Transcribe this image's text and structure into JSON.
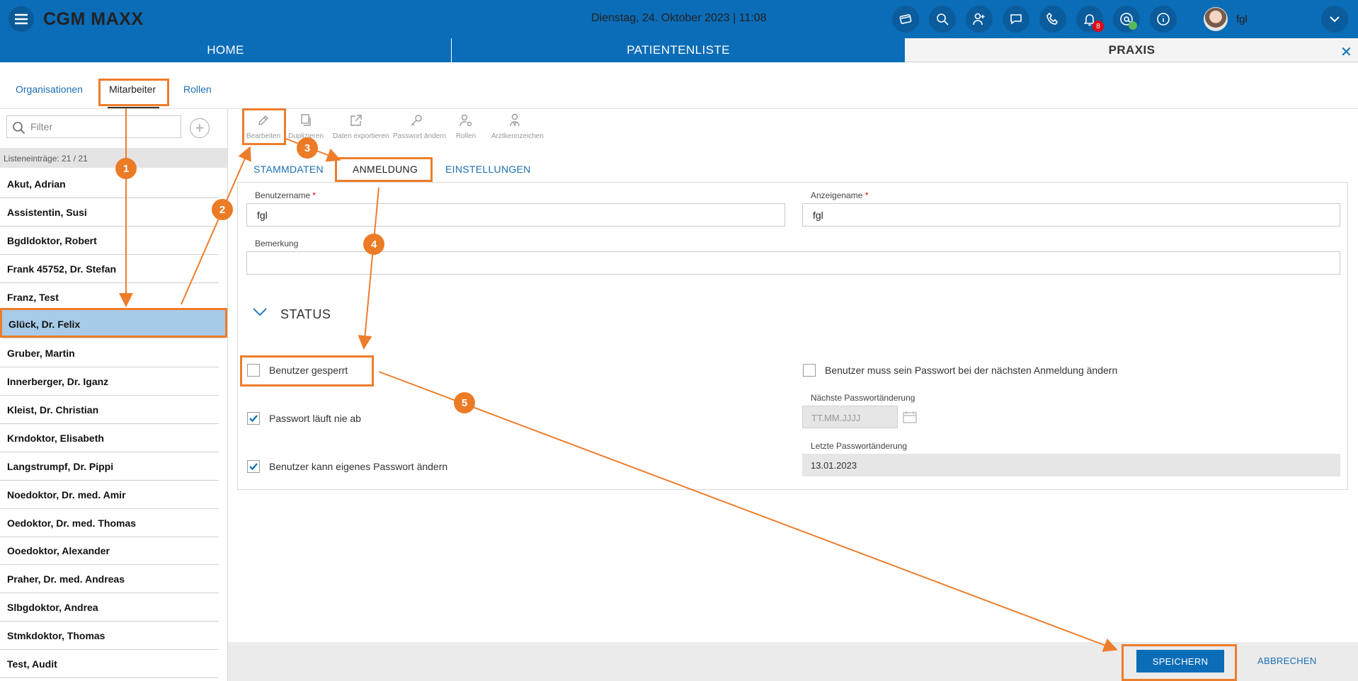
{
  "app": {
    "title": "CGM MAXX",
    "datetime": "Dienstag, 24. Oktober 2023 | 11:08",
    "username": "fgl",
    "notification_count": "8"
  },
  "main_tabs": [
    {
      "label": "HOME"
    },
    {
      "label": "PATIENTENLISTE"
    },
    {
      "label": "PRAXIS"
    }
  ],
  "sub_tabs": [
    {
      "label": "Organisationen"
    },
    {
      "label": "Mitarbeiter"
    },
    {
      "label": "Rollen"
    }
  ],
  "list": {
    "filter_placeholder": "Filter",
    "count_text": "Listeneinträge: 21 / 21",
    "items": [
      "Akut, Adrian",
      "Assistentin, Susi",
      "Bgdldoktor, Robert",
      "Frank 45752, Dr. Stefan",
      "Franz, Test",
      "Glück, Dr. Felix",
      "Gruber, Martin",
      "Innerberger, Dr. Iganz",
      "Kleist, Dr. Christian",
      "Krndoktor, Elisabeth",
      "Langstrumpf, Dr. Pippi",
      "Noedoktor, Dr. med. Amir",
      "Oedoktor, Dr. med. Thomas",
      "Ooedoktor, Alexander",
      "Praher, Dr. med. Andreas",
      "Slbgdoktor, Andrea",
      "Stmkdoktor, Thomas",
      "Test, Audit"
    ],
    "selected_index": 5
  },
  "toolbar": [
    {
      "label": "Bearbeiten",
      "icon": "pencil-icon"
    },
    {
      "label": "Duplizieren",
      "icon": "duplicate-icon"
    },
    {
      "label": "Daten exportieren",
      "icon": "export-icon"
    },
    {
      "label": "Passwort ändern",
      "icon": "key-icon"
    },
    {
      "label": "Rollen",
      "icon": "user-gear-icon"
    },
    {
      "label": "Arztkennzeichen",
      "icon": "doctor-icon"
    }
  ],
  "content_tabs": [
    {
      "label": "STAMMDATEN"
    },
    {
      "label": "ANMELDUNG"
    },
    {
      "label": "EINSTELLUNGEN"
    }
  ],
  "form": {
    "benutzername_label": "Benutzername",
    "benutzername_value": "fgl",
    "anzeigename_label": "Anzeigename",
    "anzeigename_value": "fgl",
    "required_marker": "*",
    "bemerkung_label": "Bemerkung",
    "bemerkung_value": "",
    "status_title": "STATUS",
    "benutzer_gesperrt_label": "Benutzer gesperrt",
    "benutzer_gesperrt_checked": false,
    "passwort_nie_ab_label": "Passwort läuft nie ab",
    "passwort_nie_ab_checked": true,
    "eigenes_passwort_label": "Benutzer kann eigenes Passwort ändern",
    "eigenes_passwort_checked": true,
    "muss_aendern_label": "Benutzer muss sein Passwort bei der nächsten Anmeldung ändern",
    "muss_aendern_checked": false,
    "naechste_label": "Nächste Passwortänderung",
    "naechste_placeholder": "TT.MM.JJJJ",
    "letzte_label": "Letzte Passwortänderung",
    "letzte_value": "13.01.2023"
  },
  "actions": {
    "save_label": "SPEICHERN",
    "cancel_label": "ABBRECHEN"
  },
  "annotation": {
    "color": "#ee7d2b",
    "steps": [
      "1",
      "2",
      "3",
      "4",
      "5"
    ]
  },
  "colors": {
    "brand_blue": "#0b6cb7",
    "selected_row": "#a7cbe8",
    "badge_red": "#e30613"
  }
}
